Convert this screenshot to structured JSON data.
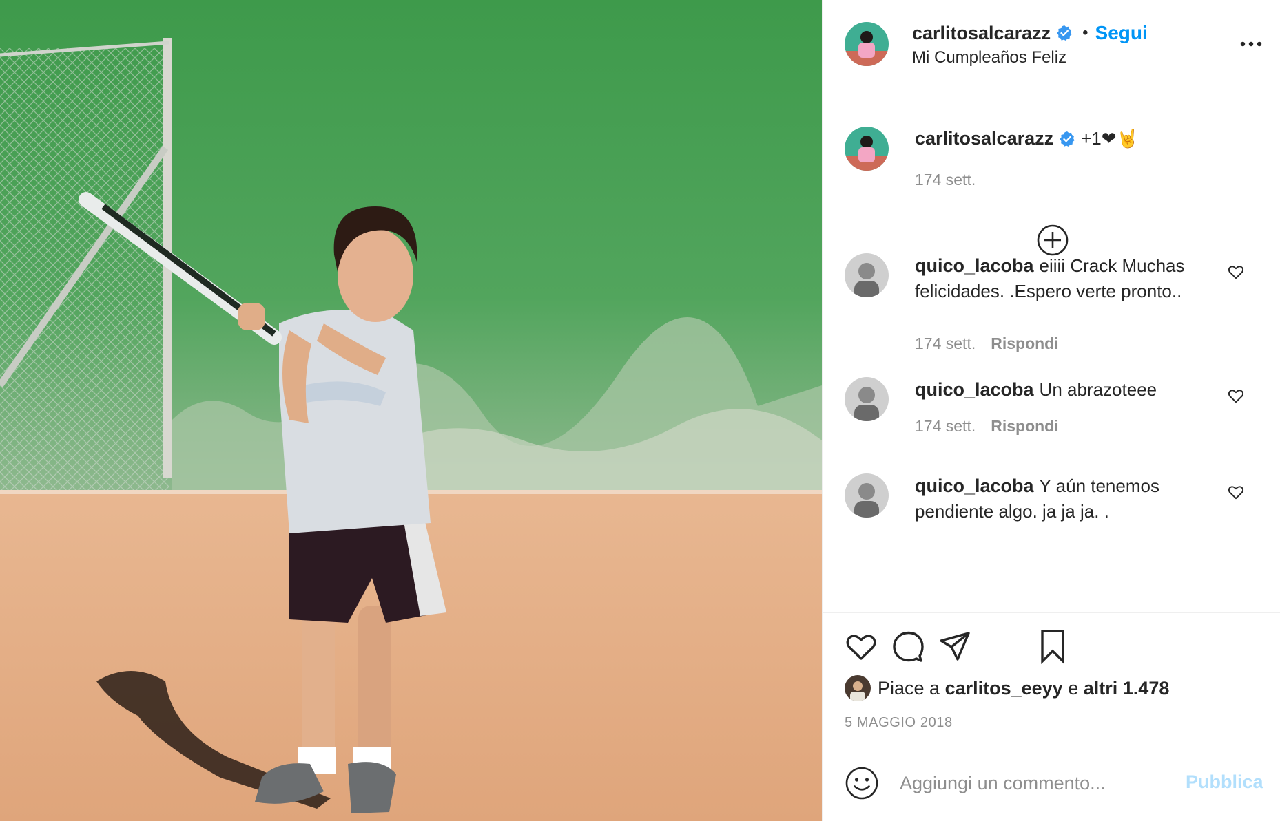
{
  "post": {
    "image_alt": "Bambino che gioca a tennis"
  },
  "header": {
    "username": "carlitosalcarazz",
    "separator": "•",
    "follow_label": "Segui",
    "location": "Mi Cumpleaños Feliz",
    "more_icon": "more-horizontal-icon"
  },
  "caption": {
    "username": "carlitosalcarazz",
    "text": "+1❤🤘",
    "time": "174 sett."
  },
  "comments": [
    {
      "username": "quico_lacoba",
      "text": "eiiii Crack Muchas felicidades. .Espero verte pronto..",
      "time": "174 sett.",
      "reply_label": "Rispondi"
    },
    {
      "username": "quico_lacoba",
      "text": "Un abrazoteee",
      "time": "174 sett.",
      "reply_label": "Rispondi"
    },
    {
      "username": "quico_lacoba",
      "text": "Y aún tenemos pendiente algo. ja ja ja. ."
    }
  ],
  "actions": {
    "like_icon": "heart-icon",
    "comment_icon": "comment-icon",
    "share_icon": "paper-plane-icon",
    "save_icon": "bookmark-icon"
  },
  "likes": {
    "prefix": "Piace a",
    "user": "carlitos_eeyy",
    "joiner": "e",
    "others": "altri 1.478"
  },
  "date": "5 MAGGIO 2018",
  "add_comment": {
    "placeholder": "Aggiungi un commento...",
    "publish_label": "Pubblica"
  },
  "colors": {
    "accent": "#0095f6",
    "publish_disabled": "#b2dffc",
    "secondary_text": "#8e8e8e",
    "border": "#efefef",
    "verified_badge": "#3897f0"
  }
}
